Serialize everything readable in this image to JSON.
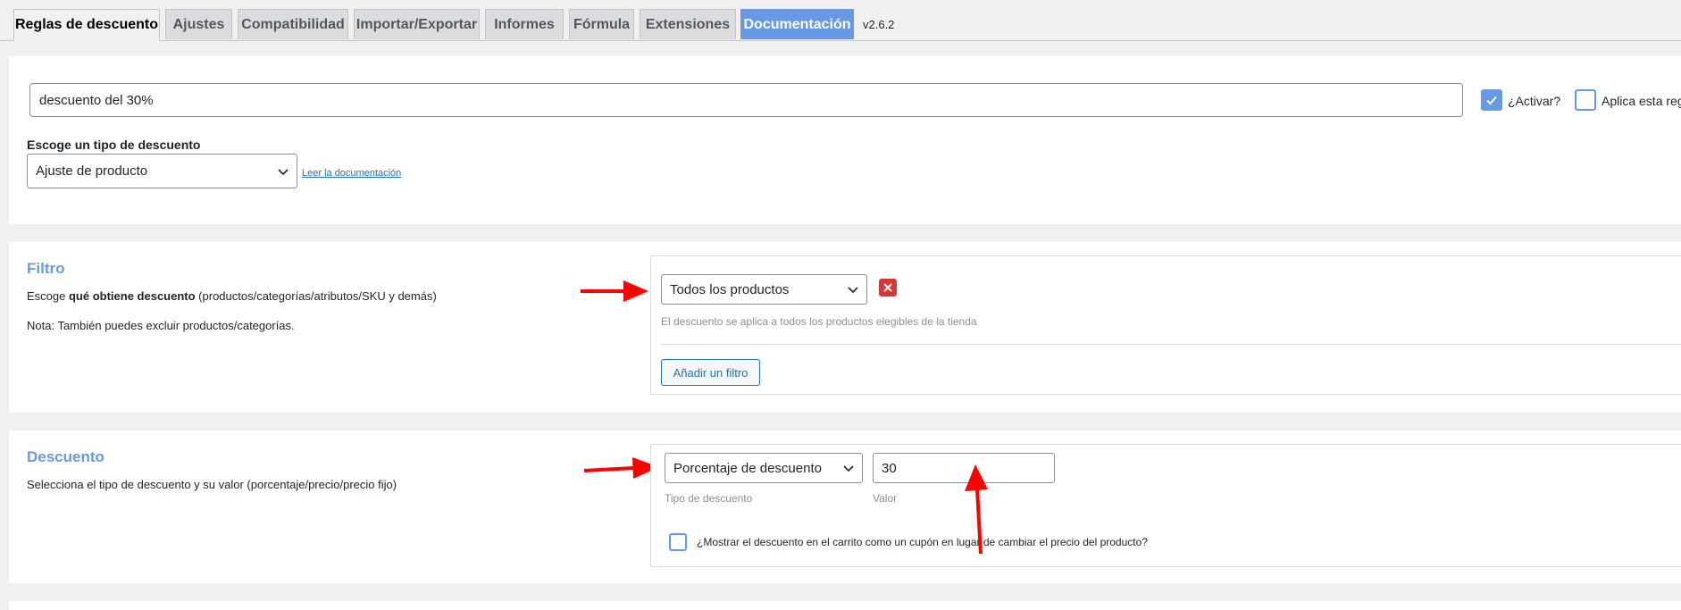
{
  "tabs": [
    {
      "label": "Reglas de descuento"
    },
    {
      "label": "Ajustes"
    },
    {
      "label": "Compatibilidad"
    },
    {
      "label": "Importar/Exportar"
    },
    {
      "label": "Informes"
    },
    {
      "label": "Fórmula"
    },
    {
      "label": "Extensiones"
    },
    {
      "label": "Documentación"
    }
  ],
  "version": "v2.6.2",
  "rule": {
    "title_value": "descuento del 30%",
    "activate_label": "¿Activar?",
    "activate_checked": true,
    "apply_label": "Aplica esta reg",
    "apply_checked": false,
    "discount_type_label": "Escoge un tipo de descuento",
    "discount_type_value": "Ajuste de producto",
    "doc_link": "Leer la documentación"
  },
  "filter": {
    "title": "Filtro",
    "desc_prefix": "Escoge ",
    "desc_bold": "qué obtiene descuento",
    "desc_suffix": " (productos/categorías/atributos/SKU y demás)",
    "note": "Nota: También puedes excluir productos/categorías.",
    "select_value": "Todos los productos",
    "hint": "El descuento se aplica a todos los productos elegibles de la tienda",
    "add_button": "Añadir un filtro"
  },
  "discount": {
    "title": "Descuento",
    "desc": "Selecciona el tipo de descuento y su valor (porcentaje/precio/precio fijo)",
    "type_value": "Porcentaje de descuento",
    "type_label": "Tipo de descuento",
    "value": "30",
    "value_label": "Valor",
    "coupon_label": "¿Mostrar el descuento en el carrito como un cupón en lugar de cambiar el precio del producto?",
    "coupon_checked": false
  },
  "colors": {
    "accent": "#6799e4",
    "link": "#2271b1",
    "danger": "#d63638",
    "annotation_arrow": "#ff0000"
  }
}
